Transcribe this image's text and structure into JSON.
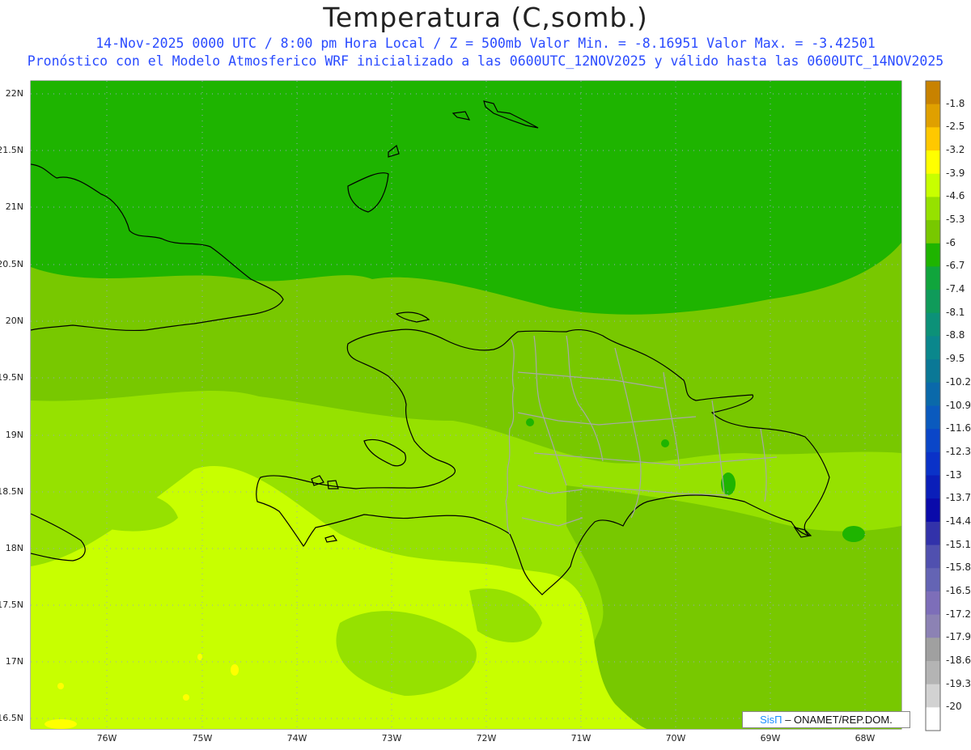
{
  "header": {
    "title": "Temperatura (C,somb.)",
    "subtitle1": "14-Nov-2025  0000 UTC / 8:00 pm Hora Local / Z = 500mb  Valor Min. = -8.16951  Valor Max. = -3.42501",
    "subtitle2": "Pronóstico con el Modelo Atmosferico WRF inicializado a las 0600UTC_12NOV2025 y válido hasta las  0600UTC_14NOV2025"
  },
  "axes": {
    "lat_labels": [
      "22N",
      "21.5N",
      "21N",
      "20.5N",
      "20N",
      "19.5N",
      "19N",
      "18.5N",
      "18N",
      "17.5N",
      "17N",
      "16.5N"
    ],
    "lon_labels": [
      "76W",
      "75W",
      "74W",
      "73W",
      "72W",
      "71W",
      "70W",
      "69W",
      "68W"
    ]
  },
  "colorbar": {
    "labels": [
      "-1.8",
      "-2.5",
      "-3.2",
      "-3.9",
      "-4.6",
      "-5.3",
      "-6",
      "-6.7",
      "-7.4",
      "-8.1",
      "-8.8",
      "-9.5",
      "-10.2",
      "-10.9",
      "-11.6",
      "-12.3",
      "-13",
      "-13.7",
      "-14.4",
      "-15.1",
      "-15.8",
      "-16.5",
      "-17.2",
      "-17.9",
      "-18.6",
      "-19.3",
      "-20"
    ],
    "colors": [
      "#c88200",
      "#e0a000",
      "#ffc800",
      "#ffff00",
      "#c8ff00",
      "#96e100",
      "#78c800",
      "#1eb400",
      "#10a53c",
      "#0f9b5a",
      "#0c9178",
      "#0a878c",
      "#0a7896",
      "#0a69aa",
      "#0a5abe",
      "#0a46c8",
      "#0a32c8",
      "#0a1eb9",
      "#0a0aaa",
      "#3232aa",
      "#5050af",
      "#6464b4",
      "#7d6eb9",
      "#8c82b4",
      "#a0a0a0",
      "#b4b4b4",
      "#d2d2d2"
    ]
  },
  "credit": {
    "brand": "SisΠ",
    "text": "– ONAMET/REP.DOM."
  }
}
